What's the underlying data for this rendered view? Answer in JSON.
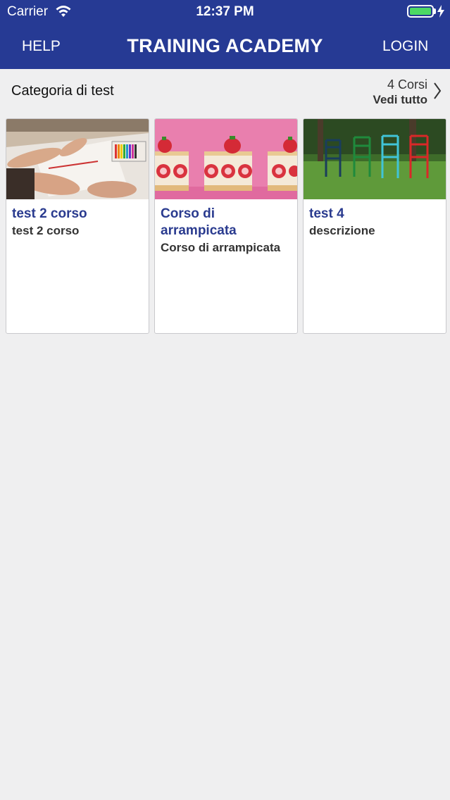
{
  "status_bar": {
    "carrier": "Carrier",
    "time": "12:37 PM",
    "battery_color": "#4cd964"
  },
  "header": {
    "help_label": "HELP",
    "title": "TRAINING ACADEMY",
    "login_label": "LOGIN",
    "bg_color": "#263a94"
  },
  "category": {
    "title": "Categoria di test",
    "count": "4 Corsi",
    "see_all": "Vedi tutto"
  },
  "courses": [
    {
      "title": "test 2 corso",
      "description": "test 2 corso",
      "image": "drawing-hands-photo"
    },
    {
      "title": "Corso di arrampicata",
      "description": "Corso di arrampicata",
      "image": "strawberry-cakes-photo"
    },
    {
      "title": "test 4",
      "description": "descrizione",
      "image": "colored-chairs-photo"
    }
  ]
}
